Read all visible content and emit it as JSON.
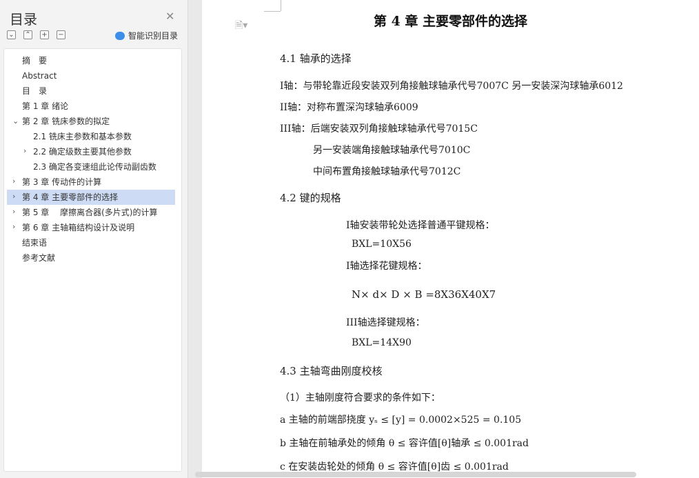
{
  "sidebar": {
    "title": "目录",
    "smart_toc_label": "智能识别目录",
    "items": [
      {
        "label": "摘　要"
      },
      {
        "label": "Abstract"
      },
      {
        "label": "目　录"
      },
      {
        "label": "第 1 章  绪论"
      },
      {
        "label": "第 2 章  铣床参数的拟定"
      },
      {
        "label": "2.1 铣床主参数和基本参数"
      },
      {
        "label": "2.2 确定级数主要其他参数"
      },
      {
        "label": "2.3  确定各变速组此论传动副齿数"
      },
      {
        "label": "第 3 章  传动件的计算"
      },
      {
        "label": "第 4 章  主要零部件的选择"
      },
      {
        "label": "第 5 章　 摩擦离合器(多片式)的计算"
      },
      {
        "label": "第 6 章  主轴箱结构设计及说明"
      },
      {
        "label": "结束语"
      },
      {
        "label": "参考文献"
      }
    ]
  },
  "document": {
    "chapter_title": "第 4 章  主要零部件的选择",
    "lines": [
      "4.1  轴承的选择",
      "I轴：与带轮靠近段安装双列角接触球轴承代号7007C  另一安装深沟球轴承6012",
      "II轴：对称布置深沟球轴承6009",
      "III轴：后端安装双列角接触球轴承代号7015C",
      "另一安装端角接触球轴承代号7010C",
      "中间布置角接触球轴承代号7012C",
      "4.2  键的规格",
      "I轴安装带轮处选择普通平键规格：",
      "BXL=10X56",
      "I轴选择花键规格：",
      "N× d× D × B  =8X36X40X7",
      "III轴选择键规格：",
      "BXL=14X90",
      "4.3  主轴弯曲刚度校核",
      "（1）主轴刚度符合要求的条件如下：",
      "a 主轴的前端部挠度 yₛ ≤ [y] = 0.0002×525 = 0.105",
      "b 主轴在前轴承处的倾角 θ ≤ 容许值[θ]轴承 ≤ 0.001rad",
      "c 在安装齿轮处的倾角 θ ≤ 容许值[θ]齿 ≤ 0.001rad"
    ]
  }
}
